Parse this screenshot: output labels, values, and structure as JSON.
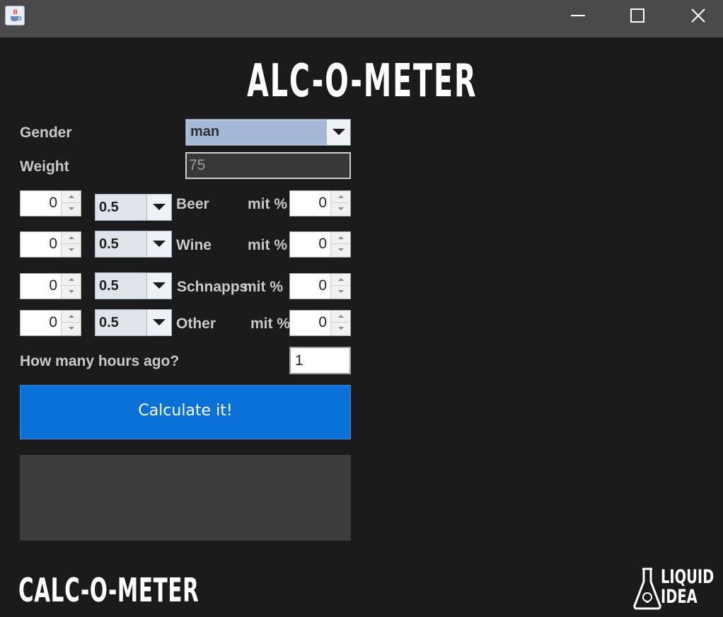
{
  "window": {
    "icon": "java-cup-icon",
    "controls": [
      "minimize-icon",
      "maximize-icon",
      "close-icon"
    ]
  },
  "heading": "ALC-O-METER",
  "form": {
    "gender_label": "Gender",
    "gender_value": "man",
    "weight_label": "Weight",
    "weight_value": "75",
    "drinks": [
      {
        "count": "0",
        "size": "0.5",
        "label": "Beer",
        "pct_label": "mit %",
        "pct": "0"
      },
      {
        "count": "0",
        "size": "0.5",
        "label": "Wine",
        "pct_label": "mit %",
        "pct": "0"
      },
      {
        "count": "0",
        "size": "0.5",
        "label": "Schnapps",
        "pct_label": "mit %",
        "pct": "0"
      },
      {
        "count": "0",
        "size": "0.5",
        "label": "Other",
        "pct_label": "mit %",
        "pct": "0"
      }
    ],
    "hours_label": "How many hours ago?",
    "hours_value": "1",
    "calculate_label": "Calculate it!",
    "result_text": ""
  },
  "footer": {
    "brand": "CALC-O-METER",
    "logo_line1": "LIQUID",
    "logo_line2": "IDEA"
  },
  "colors": {
    "background": "#1b1b1b",
    "titlebar": "#4a4a4a",
    "button": "#0a71d9",
    "result": "#3d3d3d"
  }
}
